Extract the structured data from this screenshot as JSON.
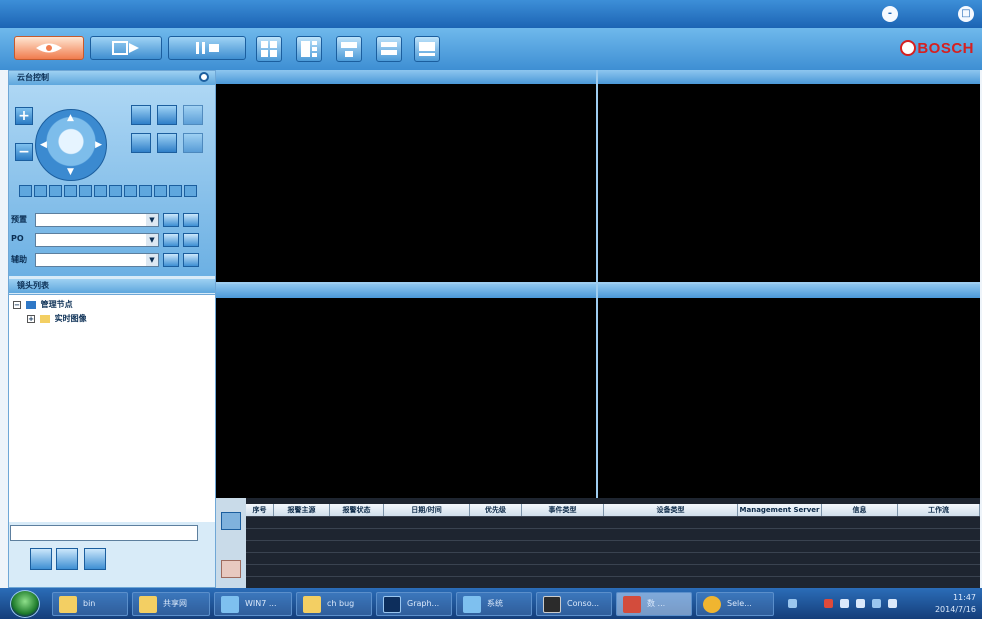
{
  "window": {
    "title": "",
    "controls": [
      "-",
      "□"
    ]
  },
  "toolbar": {
    "mode_buttons": [
      "live-view",
      "playback",
      "pause"
    ],
    "layout_buttons": [
      "layout-4",
      "layout-1-3",
      "layout-2",
      "layout-2b",
      "layout-1"
    ],
    "brand": "BOSCH"
  },
  "ptz": {
    "section_title": "云台控制",
    "zoom_in": "+",
    "zoom_out": "−",
    "preset_label": "预置",
    "po_label": "PO",
    "aux_label": "辅助",
    "preset_value": "",
    "po_value": "",
    "aux_value": ""
  },
  "tree": {
    "section_title": "镜头列表",
    "root": "管理节点",
    "child": "实时图像"
  },
  "search": {
    "value": ""
  },
  "alarm_table": {
    "columns": [
      "序号",
      "报警主源",
      "报警状态",
      "日期/时间",
      "优先级",
      "事件类型",
      "设备类型",
      "Management Server",
      "信息",
      "工作流"
    ]
  },
  "taskbar": {
    "tasks": [
      {
        "label": "bin",
        "icon": "folder-icon"
      },
      {
        "label": "共享网",
        "icon": "folder-icon"
      },
      {
        "label": "WIN7 ...",
        "icon": "network-icon"
      },
      {
        "label": "ch bug",
        "icon": "folder-icon"
      },
      {
        "label": "Graph...",
        "icon": "graph-icon"
      },
      {
        "label": "系统",
        "icon": "app-icon"
      },
      {
        "label": "Conso...",
        "icon": "console-icon"
      },
      {
        "label": "数 ...",
        "icon": "app-icon"
      },
      {
        "label": "Sele...",
        "icon": "app-icon"
      }
    ],
    "clock_time": "11:47",
    "clock_date": "2014/7/16"
  },
  "colors": {
    "accent": "#3e8fd3",
    "brand": "#d62020",
    "active_tool": "#f07c4e"
  }
}
